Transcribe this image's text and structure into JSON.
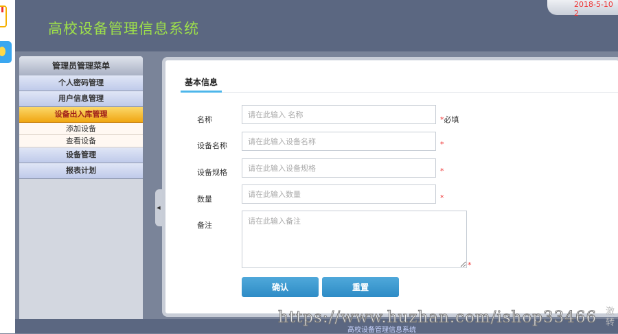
{
  "header": {
    "title": "高校设备管理信息系统",
    "datetime": "2018-5-10 2"
  },
  "sidebar": {
    "title": "管理员管理菜单",
    "items": [
      {
        "label": "个人密码管理"
      },
      {
        "label": "用户信息管理"
      },
      {
        "label": "设备出入库管理",
        "active": true,
        "children": [
          {
            "label": "添加设备"
          },
          {
            "label": "查看设备"
          }
        ]
      },
      {
        "label": "设备管理"
      },
      {
        "label": "报表计划"
      }
    ]
  },
  "main": {
    "tab": "基本信息",
    "fields": [
      {
        "label": "名称",
        "placeholder": "请在此输入 名称",
        "required": "*",
        "note": "必填"
      },
      {
        "label": "设备名称",
        "placeholder": "请在此输入设备名称",
        "required": "*"
      },
      {
        "label": "设备规格",
        "placeholder": "请在此输入设备规格",
        "required": "*"
      },
      {
        "label": "数量",
        "placeholder": "请在此输入数量",
        "required": "*"
      },
      {
        "label": "备注",
        "placeholder": "请在此输入备注",
        "required": "*"
      }
    ],
    "confirm": "确认",
    "reset": "重置"
  },
  "footer": {
    "text": "高校设备管理信息系统"
  },
  "watermark": {
    "url": "https://www.huzhan.com/ishop33466",
    "side1": "激",
    "side2": "转"
  },
  "colors": {
    "header": "#5b6781",
    "title": "#9ee04a",
    "active_menu": "#f0a612",
    "button": "#3a98d0"
  }
}
